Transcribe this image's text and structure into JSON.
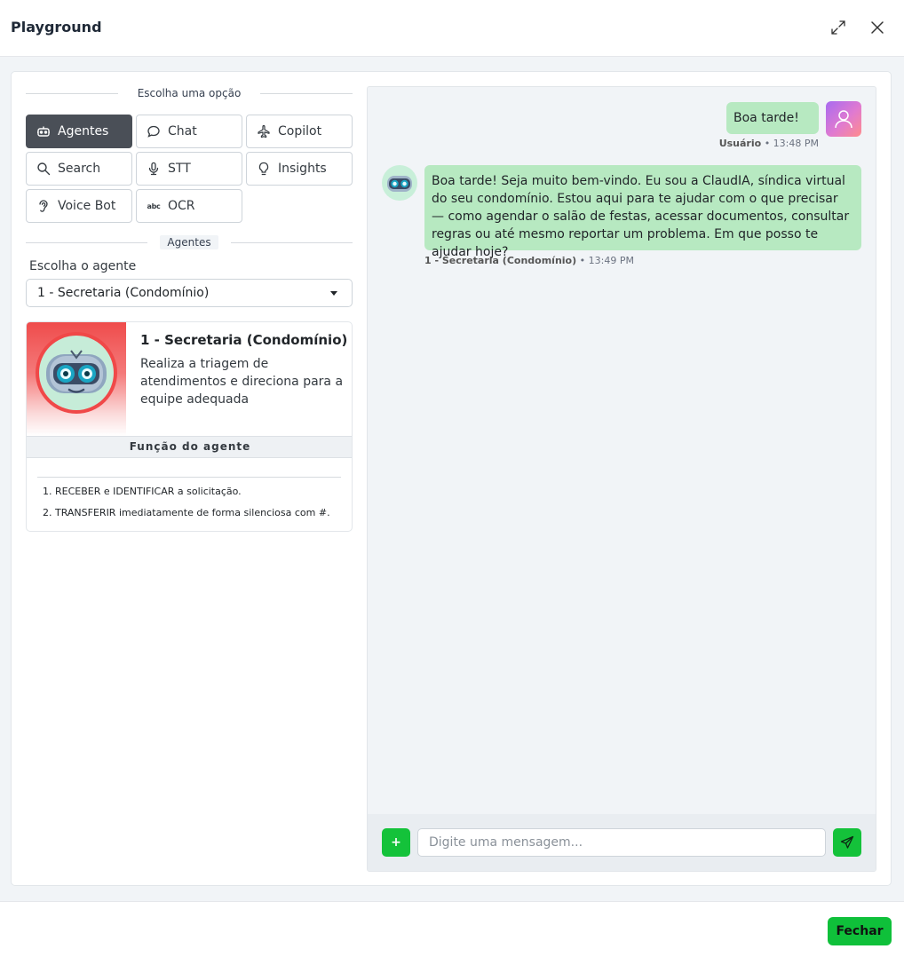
{
  "header": {
    "title": "Playground",
    "expand_icon": "expand-icon",
    "close_icon": "close-icon"
  },
  "options": {
    "section_label": "Escolha uma opção",
    "items": [
      {
        "label": "Agentes",
        "icon": "robot-icon",
        "active": true
      },
      {
        "label": "Chat",
        "icon": "chat-bubble-icon",
        "active": false
      },
      {
        "label": "Copilot",
        "icon": "airplane-icon",
        "active": false
      },
      {
        "label": "Search",
        "icon": "search-icon",
        "active": false
      },
      {
        "label": "STT",
        "icon": "microphone-icon",
        "active": false
      },
      {
        "label": "Insights",
        "icon": "lightbulb-icon",
        "active": false
      },
      {
        "label": "Voice Bot",
        "icon": "ear-icon",
        "active": false
      },
      {
        "label": "OCR",
        "icon": "abc-icon",
        "active": false
      }
    ]
  },
  "agents": {
    "section_label": "Agentes",
    "field_label": "Escolha o agente",
    "selected": "1 - Secretaria (Condomínio)",
    "card": {
      "name": "1 - Secretaria (Condomínio)",
      "description": "Realiza a triagem de atendimentos e direciona para a equipe adequada",
      "function_title": "Função do agente",
      "function_items": [
        "1. RECEBER e IDENTIFICAR a solicitação.",
        "2. TRANSFERIR imediatamente de forma silenciosa com #."
      ]
    }
  },
  "chat": {
    "messages": [
      {
        "role": "user",
        "text": "Boa tarde!",
        "sender": "Usuário",
        "time": "• 13:48 PM"
      },
      {
        "role": "bot",
        "text": "Boa tarde! Seja muito bem-vindo. Eu sou a ClaudIA, síndica virtual do seu condomínio. Estou aqui para te ajudar com o que precisar — como agendar o salão de festas, acessar documentos, consultar regras ou até mesmo reportar um problema. Em que posso te ajudar hoje?",
        "sender": "1 - Secretaria (Condomínio)",
        "time": "• 13:49 PM"
      }
    ],
    "input_placeholder": "Digite uma mensagem...",
    "input_value": "",
    "plus_label": "+"
  },
  "footer": {
    "close_label": "Fechar"
  },
  "colors": {
    "accent_green": "#14c23a",
    "bubble_green": "#b7e9c1",
    "active_option": "#4a4f57"
  }
}
